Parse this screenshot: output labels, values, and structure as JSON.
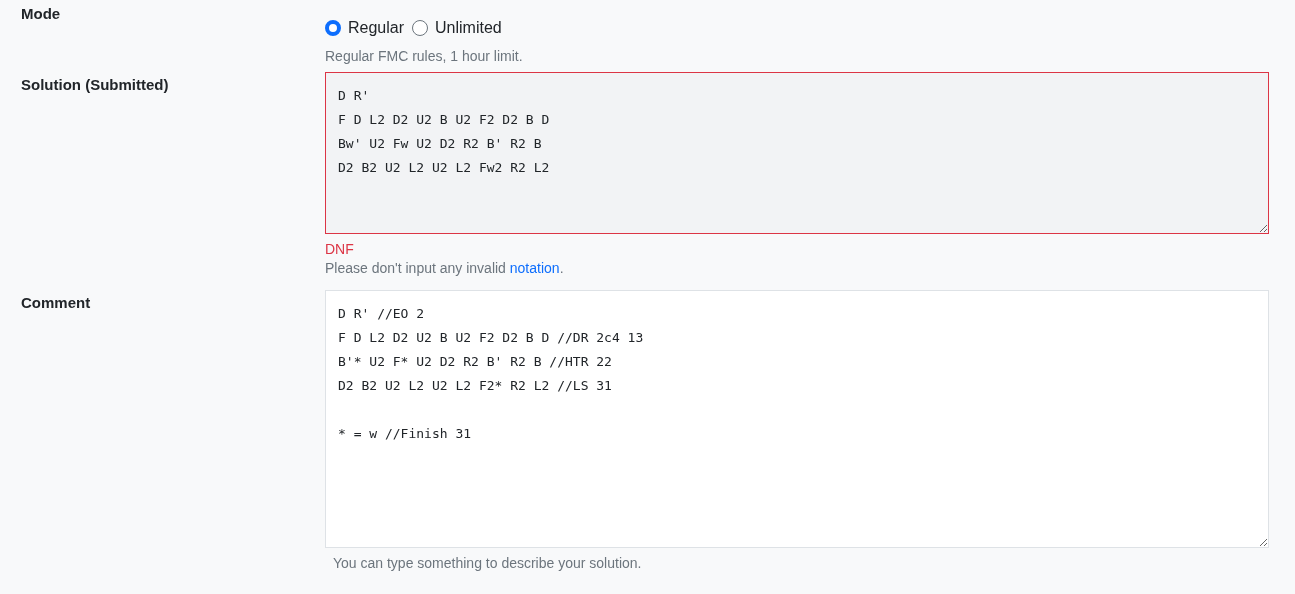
{
  "mode": {
    "label": "Mode",
    "options": [
      {
        "label": "Regular",
        "selected": true
      },
      {
        "label": "Unlimited",
        "selected": false
      }
    ],
    "help": "Regular FMC rules, 1 hour limit."
  },
  "solution": {
    "label": "Solution (Submitted)",
    "invalid": true,
    "text": "D R'\nF D L2 D2 U2 B U2 F2 D2 B D\nBw' U2 Fw U2 D2 R2 B' R2 B\nD2 B2 U2 L2 U2 L2 Fw2 R2 L2",
    "error": "DNF",
    "help": "Please don't input any invalid ",
    "help_link": "notation",
    "help_end": "."
  },
  "comment": {
    "label": "Comment",
    "invalid": false,
    "text": "D R' //EO 2\nF D L2 D2 U2 B U2 F2 D2 B D //DR 2c4 13\nB'* U2 F* U2 D2 R2 B' R2 B //HTR 22\nD2 B2 U2 L2 U2 L2 F2* R2 L2 //LS 31\n\n* = w //Finish 31",
    "help": "You can type something to describe your solution."
  }
}
